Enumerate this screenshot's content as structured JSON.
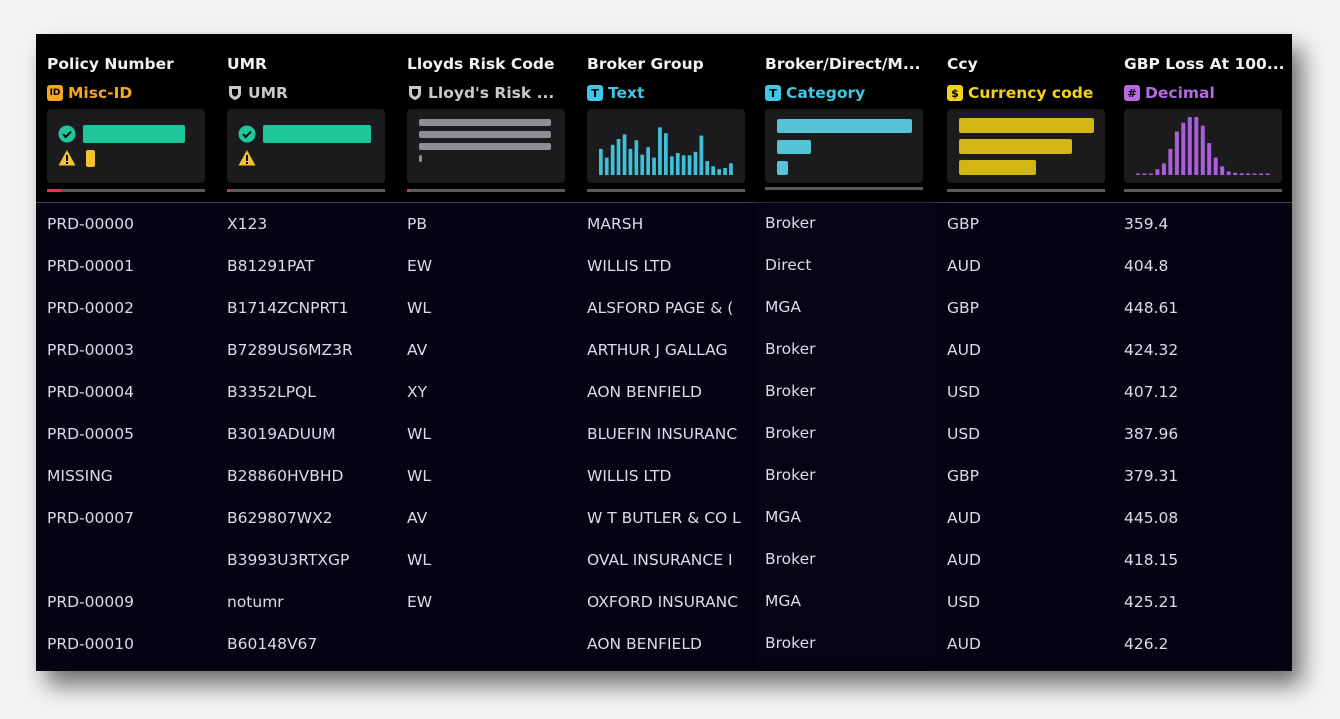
{
  "colors": {
    "misc_id": "#f5a623",
    "umr_type": "#c9c9c9",
    "text_type": "#3ec7e6",
    "category_type": "#3ec7e6",
    "currency_type": "#f2d21b",
    "decimal_type": "#b36ae2",
    "valid_green": "#1ec79a",
    "warn_yellow": "#f2c230",
    "cat_bar": "#55c2d6",
    "ccy_bar": "#d2b614",
    "decimal_bar": "#a95fd9",
    "text_bar": "#3fc0d8",
    "gray_bar": "#8e8e92"
  },
  "columns": [
    {
      "title": "Policy Number",
      "type_label": "Misc-ID",
      "type_icon": "ID",
      "icon_name": "id-icon"
    },
    {
      "title": "UMR",
      "type_label": "UMR",
      "type_icon": "shield",
      "icon_name": "shield-icon"
    },
    {
      "title": "Lloyds Risk Code",
      "type_label": "Lloyd's Risk ...",
      "type_icon": "shield",
      "icon_name": "shield-icon"
    },
    {
      "title": "Broker Group",
      "type_label": "Text",
      "type_icon": "T",
      "icon_name": "text-type-icon"
    },
    {
      "title": "Broker/Direct/M...",
      "type_label": "Category",
      "type_icon": "T",
      "icon_name": "category-type-icon"
    },
    {
      "title": "Ccy",
      "type_label": "Currency code",
      "type_icon": "$",
      "icon_name": "currency-icon"
    },
    {
      "title": "GBP Loss At 100...",
      "type_label": "Decimal",
      "type_icon": "#",
      "icon_name": "hash-icon"
    }
  ],
  "rows": [
    [
      "PRD-00000",
      "X123",
      "PB",
      "MARSH",
      "Broker",
      "GBP",
      "359.4"
    ],
    [
      "PRD-00001",
      "B81291PAT",
      "EW",
      "WILLIS LTD",
      "Direct",
      "AUD",
      "404.8"
    ],
    [
      "PRD-00002",
      "B1714ZCNPRT1",
      "WL",
      "ALSFORD PAGE & (",
      "MGA",
      "GBP",
      "448.61"
    ],
    [
      "PRD-00003",
      "B7289US6MZ3R",
      "AV",
      "ARTHUR J GALLAG",
      "Broker",
      "AUD",
      "424.32"
    ],
    [
      "PRD-00004",
      "B3352LPQL",
      "XY",
      "AON BENFIELD",
      "Broker",
      "USD",
      "407.12"
    ],
    [
      "PRD-00005",
      "B3019ADUUM",
      "WL",
      "BLUEFIN INSURANC",
      "Broker",
      "USD",
      "387.96"
    ],
    [
      "MISSING",
      "B28860HVBHD",
      "WL",
      "WILLIS LTD",
      "Broker",
      "GBP",
      "379.31"
    ],
    [
      "PRD-00007",
      "B629807WX2",
      "AV",
      "W T BUTLER & CO L",
      "MGA",
      "AUD",
      "445.08"
    ],
    [
      "",
      "B3993U3RTXGP",
      "WL",
      "OVAL INSURANCE I",
      "Broker",
      "AUD",
      "418.15"
    ],
    [
      "PRD-00009",
      "notumr",
      "EW",
      "OXFORD INSURANC",
      "MGA",
      "USD",
      "425.21"
    ],
    [
      "PRD-00010",
      "B60148V67",
      "",
      "AON BENFIELD",
      "Broker",
      "AUD",
      "426.2"
    ]
  ],
  "quality": {
    "policy_number": {
      "valid_fraction": 0.82,
      "warning_fraction": 0.07
    },
    "umr": {
      "valid_fraction": 0.87,
      "warning_fraction": 0.0
    }
  },
  "risk_code_bars": [
    0.98,
    0.98,
    0.98,
    0.02
  ],
  "broker_group_hist": [
    0.45,
    0.3,
    0.52,
    0.62,
    0.7,
    0.45,
    0.6,
    0.35,
    0.48,
    0.3,
    0.82,
    0.72,
    0.32,
    0.38,
    0.34,
    0.34,
    0.4,
    0.68,
    0.24,
    0.15,
    0.1,
    0.12,
    0.2
  ],
  "category_bars": [
    1.0,
    0.25,
    0.08
  ],
  "currency_bars": [
    1.0,
    0.84,
    0.57
  ],
  "decimal_hist": [
    0.02,
    0.02,
    0.02,
    0.1,
    0.2,
    0.45,
    0.75,
    0.9,
    1.0,
    1.0,
    0.85,
    0.55,
    0.3,
    0.15,
    0.06,
    0.04,
    0.03,
    0.02,
    0.02,
    0.02,
    0.02
  ]
}
